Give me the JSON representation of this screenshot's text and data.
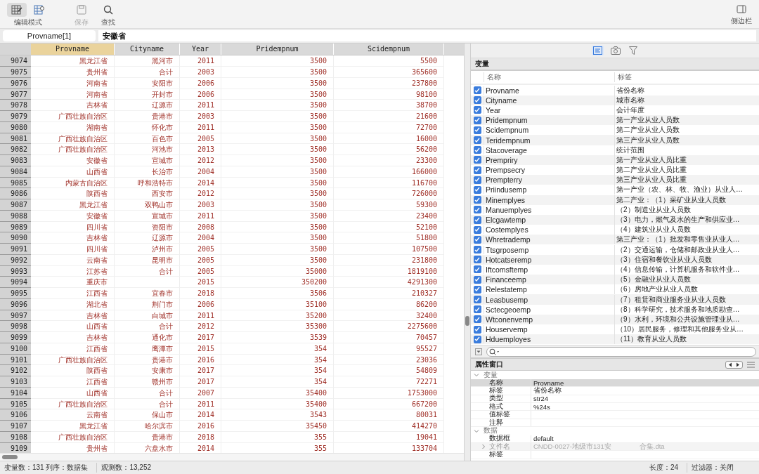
{
  "toolbar": {
    "modes": [
      {
        "selected": true
      },
      {
        "selected": false
      }
    ],
    "mode_label": "编辑模式",
    "buttons": [
      {
        "kind": "save",
        "label": "保存",
        "disabled": true
      },
      {
        "kind": "find",
        "label": "查找",
        "disabled": false
      }
    ],
    "sidebar_button": "侧边栏"
  },
  "field_bar": {
    "cell": "Provname[1]",
    "value": "安徽省"
  },
  "table": {
    "columns": [
      {
        "label": "Provname",
        "selected": true
      },
      {
        "label": "Cityname",
        "selected": false
      },
      {
        "label": "Year",
        "selected": false
      },
      {
        "label": "Pridempnum",
        "selected": false
      },
      {
        "label": "Scidempnum",
        "selected": false
      }
    ],
    "rows": [
      {
        "number": "9074",
        "cells": [
          "黑龙江省",
          "黑河市",
          "2011",
          "3500",
          "5500"
        ]
      },
      {
        "number": "9075",
        "cells": [
          "贵州省",
          "合计",
          "2003",
          "3500",
          "365600"
        ]
      },
      {
        "number": "9076",
        "cells": [
          "河南省",
          "安阳市",
          "2006",
          "3500",
          "237800"
        ]
      },
      {
        "number": "9077",
        "cells": [
          "河南省",
          "开封市",
          "2006",
          "3500",
          "98100"
        ]
      },
      {
        "number": "9078",
        "cells": [
          "吉林省",
          "辽源市",
          "2011",
          "3500",
          "38700"
        ]
      },
      {
        "number": "9079",
        "cells": [
          "广西壮族自治区",
          "贵港市",
          "2003",
          "3500",
          "21600"
        ]
      },
      {
        "number": "9080",
        "cells": [
          "湖南省",
          "怀化市",
          "2011",
          "3500",
          "72700"
        ]
      },
      {
        "number": "9081",
        "cells": [
          "广西壮族自治区",
          "百色市",
          "2005",
          "3500",
          "16000"
        ]
      },
      {
        "number": "9082",
        "cells": [
          "广西壮族自治区",
          "河池市",
          "2013",
          "3500",
          "56200"
        ]
      },
      {
        "number": "9083",
        "cells": [
          "安徽省",
          "宣城市",
          "2012",
          "3500",
          "23300"
        ]
      },
      {
        "number": "9084",
        "cells": [
          "山西省",
          "长治市",
          "2004",
          "3500",
          "166000"
        ]
      },
      {
        "number": "9085",
        "cells": [
          "内蒙古自治区",
          "呼和浩特市",
          "2014",
          "3500",
          "116700"
        ]
      },
      {
        "number": "9086",
        "cells": [
          "陕西省",
          "西安市",
          "2012",
          "3500",
          "726000"
        ]
      },
      {
        "number": "9087",
        "cells": [
          "黑龙江省",
          "双鸭山市",
          "2003",
          "3500",
          "59300"
        ]
      },
      {
        "number": "9088",
        "cells": [
          "安徽省",
          "宣城市",
          "2011",
          "3500",
          "23400"
        ]
      },
      {
        "number": "9089",
        "cells": [
          "四川省",
          "资阳市",
          "2008",
          "3500",
          "52100"
        ]
      },
      {
        "number": "9090",
        "cells": [
          "吉林省",
          "辽源市",
          "2004",
          "3500",
          "51800"
        ]
      },
      {
        "number": "9091",
        "cells": [
          "四川省",
          "泸州市",
          "2005",
          "3500",
          "107500"
        ]
      },
      {
        "number": "9092",
        "cells": [
          "云南省",
          "昆明市",
          "2005",
          "3500",
          "231800"
        ]
      },
      {
        "number": "9093",
        "cells": [
          "江苏省",
          "合计",
          "2005",
          "35000",
          "1819100"
        ]
      },
      {
        "number": "9094",
        "cells": [
          "重庆市",
          "",
          "2015",
          "350200",
          "4291300"
        ]
      },
      {
        "number": "9095",
        "cells": [
          "江西省",
          "宜春市",
          "2018",
          "3506",
          "210327"
        ]
      },
      {
        "number": "9096",
        "cells": [
          "湖北省",
          "荆门市",
          "2006",
          "35100",
          "86200"
        ]
      },
      {
        "number": "9097",
        "cells": [
          "吉林省",
          "白城市",
          "2011",
          "35200",
          "32400"
        ]
      },
      {
        "number": "9098",
        "cells": [
          "山西省",
          "合计",
          "2012",
          "35300",
          "2275600"
        ]
      },
      {
        "number": "9099",
        "cells": [
          "吉林省",
          "通化市",
          "2017",
          "3539",
          "70457"
        ]
      },
      {
        "number": "9100",
        "cells": [
          "江西省",
          "鹰潭市",
          "2015",
          "354",
          "95527"
        ]
      },
      {
        "number": "9101",
        "cells": [
          "广西壮族自治区",
          "贵港市",
          "2016",
          "354",
          "23036"
        ]
      },
      {
        "number": "9102",
        "cells": [
          "陕西省",
          "安康市",
          "2017",
          "354",
          "54809"
        ]
      },
      {
        "number": "9103",
        "cells": [
          "江西省",
          "赣州市",
          "2017",
          "354",
          "72271"
        ]
      },
      {
        "number": "9104",
        "cells": [
          "山西省",
          "合计",
          "2007",
          "35400",
          "1753000"
        ]
      },
      {
        "number": "9105",
        "cells": [
          "广西壮族自治区",
          "合计",
          "2011",
          "35400",
          "667200"
        ]
      },
      {
        "number": "9106",
        "cells": [
          "云南省",
          "保山市",
          "2014",
          "3543",
          "80031"
        ]
      },
      {
        "number": "9107",
        "cells": [
          "黑龙江省",
          "哈尔滨市",
          "2016",
          "35450",
          "414270"
        ]
      },
      {
        "number": "9108",
        "cells": [
          "广西壮族自治区",
          "贵港市",
          "2018",
          "355",
          "19041"
        ]
      },
      {
        "number": "9109",
        "cells": [
          "贵州省",
          "六盘水市",
          "2014",
          "355",
          "133704"
        ]
      }
    ]
  },
  "variables_panel": {
    "tabs": [
      {
        "kind": "variables",
        "selected": true
      },
      {
        "kind": "snapshots",
        "selected": false
      },
      {
        "kind": "filter",
        "selected": false
      }
    ],
    "title": "变量",
    "name_header": "名称",
    "label_header": "标签",
    "variables": [
      {
        "name": "Provname",
        "label": "省份名称",
        "checked": true
      },
      {
        "name": "Cityname",
        "label": "城市名称",
        "checked": true
      },
      {
        "name": "Year",
        "label": "会计年度",
        "checked": true
      },
      {
        "name": "Pridempnum",
        "label": "第一产业从业人员数",
        "checked": true
      },
      {
        "name": "Scidempnum",
        "label": "第二产业从业人员数",
        "checked": true
      },
      {
        "name": "Teridempnum",
        "label": "第三产业从业人员数",
        "checked": true
      },
      {
        "name": "Stacoverage",
        "label": "统计范围",
        "checked": true
      },
      {
        "name": "Prempriry",
        "label": "第一产业从业人员比重",
        "checked": true
      },
      {
        "name": "Prempsecry",
        "label": "第二产业从业人员比重",
        "checked": true
      },
      {
        "name": "Prempterry",
        "label": "第三产业从业人员比重",
        "checked": true
      },
      {
        "name": "Priindusemp",
        "label": "第一产业（农、林、牧、渔业）从业人…",
        "checked": true
      },
      {
        "name": "Minemplyes",
        "label": "第二产业：（1）采矿业从业人员数",
        "checked": true
      },
      {
        "name": "Manuemplyes",
        "label": "（2）制造业从业人员数",
        "checked": true
      },
      {
        "name": "Elcgawtemp",
        "label": "（3）电力，燃气及水的生产和供应业…",
        "checked": true
      },
      {
        "name": "Costemplyes",
        "label": "（4）建筑业从业人员数",
        "checked": true
      },
      {
        "name": "Whretrademp",
        "label": "第三产业：（1）批发和零售业从业人…",
        "checked": true
      },
      {
        "name": "Ttsgrposemp",
        "label": "（2）交通运输，仓储和邮政业从业人…",
        "checked": true
      },
      {
        "name": "Hotcatseremp",
        "label": "（3）住宿和餐饮业从业人员数",
        "checked": true
      },
      {
        "name": "Iftcomsftemp",
        "label": "（4）信息传输，计算机服务和软件业…",
        "checked": true
      },
      {
        "name": "Financeemp",
        "label": "（5）金融业从业人员数",
        "checked": true
      },
      {
        "name": "Relestatemp",
        "label": "（6）房地产业从业人员数",
        "checked": true
      },
      {
        "name": "Leasbusemp",
        "label": "（7）租赁和商业服务业从业人员数",
        "checked": true
      },
      {
        "name": "Sctecgeoemp",
        "label": "（8）科学研究，技术服务和地质勘查…",
        "checked": true
      },
      {
        "name": "Wtconenvemp",
        "label": "（9）水利，环境和公共设施管理业从…",
        "checked": true
      },
      {
        "name": "Houservemp",
        "label": "（10）居民服务，修理和其他服务业从…",
        "checked": true
      },
      {
        "name": "Hduemployes",
        "label": "（11）教育从业人员数",
        "checked": true
      }
    ]
  },
  "properties_panel": {
    "title": "属性窗口",
    "sections": [
      {
        "title": "变量",
        "expanded": true,
        "rows": [
          {
            "label": "名称",
            "value": "Provname",
            "selected": true,
            "disabled": false
          },
          {
            "label": "标签",
            "value": "省份名称",
            "selected": false,
            "disabled": false
          },
          {
            "label": "类型",
            "value": "str24",
            "selected": false,
            "disabled": false
          },
          {
            "label": "格式",
            "value": "%24s",
            "selected": false,
            "disabled": false
          },
          {
            "label": "值标签",
            "selected": false,
            "disabled": false
          },
          {
            "label": "注释",
            "selected": false,
            "disabled": false
          }
        ]
      },
      {
        "title": "数据",
        "expanded": true,
        "rows": [
          {
            "label": "数据框",
            "value": "default",
            "selected": false,
            "disabled": false
          },
          {
            "label": "文件名",
            "value": "CNDD-0027-地级市131安",
            "value_end": "合集.dta",
            "selected": false,
            "disabled": true,
            "expanded": false
          },
          {
            "label": "标签",
            "selected": false,
            "disabled": false
          }
        ]
      }
    ]
  },
  "status_bar": {
    "variables": "变量数：131 列序：数据集",
    "observations": "观测数：13,252",
    "length": "长度：24",
    "filter": "过滤器：关闭"
  }
}
